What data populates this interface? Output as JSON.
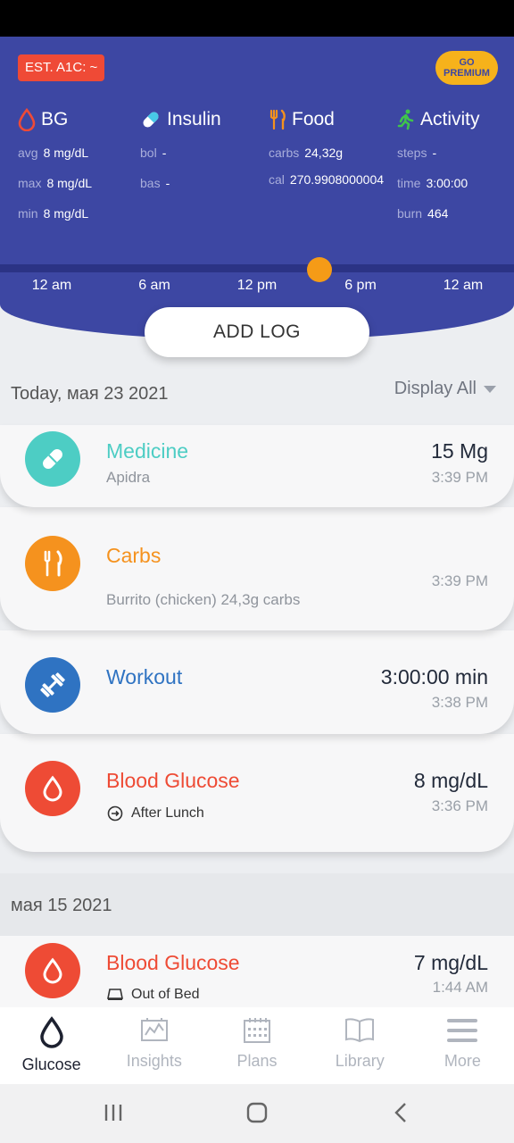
{
  "header": {
    "a1c_label": "EST. A1C: ~",
    "premium_label": "GO\nPREMIUM",
    "columns": [
      {
        "title": "BG",
        "icon": "drop-icon",
        "stats": [
          {
            "k": "avg",
            "v": "8 mg/dL"
          },
          {
            "k": "max",
            "v": "8 mg/dL"
          },
          {
            "k": "min",
            "v": "8 mg/dL"
          }
        ]
      },
      {
        "title": "Insulin",
        "icon": "pill-icon",
        "stats": [
          {
            "k": "bol",
            "v": "-"
          },
          {
            "k": "bas",
            "v": "-"
          }
        ]
      },
      {
        "title": "Food",
        "icon": "fork-knife-icon",
        "stats": [
          {
            "k": "carbs",
            "v": "24,32g"
          },
          {
            "k": "cal",
            "v": "270.9908000004"
          }
        ]
      },
      {
        "title": "Activity",
        "icon": "runner-icon",
        "stats": [
          {
            "k": "steps",
            "v": "-"
          },
          {
            "k": "time",
            "v": "3:00:00"
          },
          {
            "k": "burn",
            "v": "464"
          }
        ]
      }
    ],
    "timeline_labels": [
      "12 am",
      "6 am",
      "12 pm",
      "6 pm",
      "12 am"
    ]
  },
  "add_log_label": "ADD LOG",
  "day1": {
    "date": "Today, мая 23 2021",
    "filter": "Display All"
  },
  "entries": [
    {
      "title": "Medicine",
      "sub": "Apidra",
      "value": "15 Mg",
      "time": "3:39 PM",
      "color": "#4dcdc4"
    },
    {
      "title": "Carbs",
      "sub": "Burrito (chicken) 24,3g carbs",
      "value": "",
      "time": "3:39 PM",
      "color": "#f5921e"
    },
    {
      "title": "Workout",
      "sub": "",
      "value": "3:00:00 min",
      "time": "3:38 PM",
      "color": "#2f73c2"
    },
    {
      "title": "Blood Glucose",
      "tag": "After Lunch",
      "value": "8 mg/dL",
      "time": "3:36 PM",
      "color": "#ee4b35"
    }
  ],
  "day2": {
    "date": "мая 15 2021",
    "entry": {
      "title": "Blood Glucose",
      "tag": "Out of Bed",
      "value": "7 mg/dL",
      "time": "1:44 AM",
      "color": "#ee4b35"
    }
  },
  "nav": [
    {
      "label": "Glucose",
      "icon": "drop-outline-icon",
      "active": true
    },
    {
      "label": "Insights",
      "icon": "chart-icon",
      "active": false
    },
    {
      "label": "Plans",
      "icon": "calendar-icon",
      "active": false
    },
    {
      "label": "Library",
      "icon": "book-icon",
      "active": false
    },
    {
      "label": "More",
      "icon": "menu-icon",
      "active": false
    }
  ]
}
